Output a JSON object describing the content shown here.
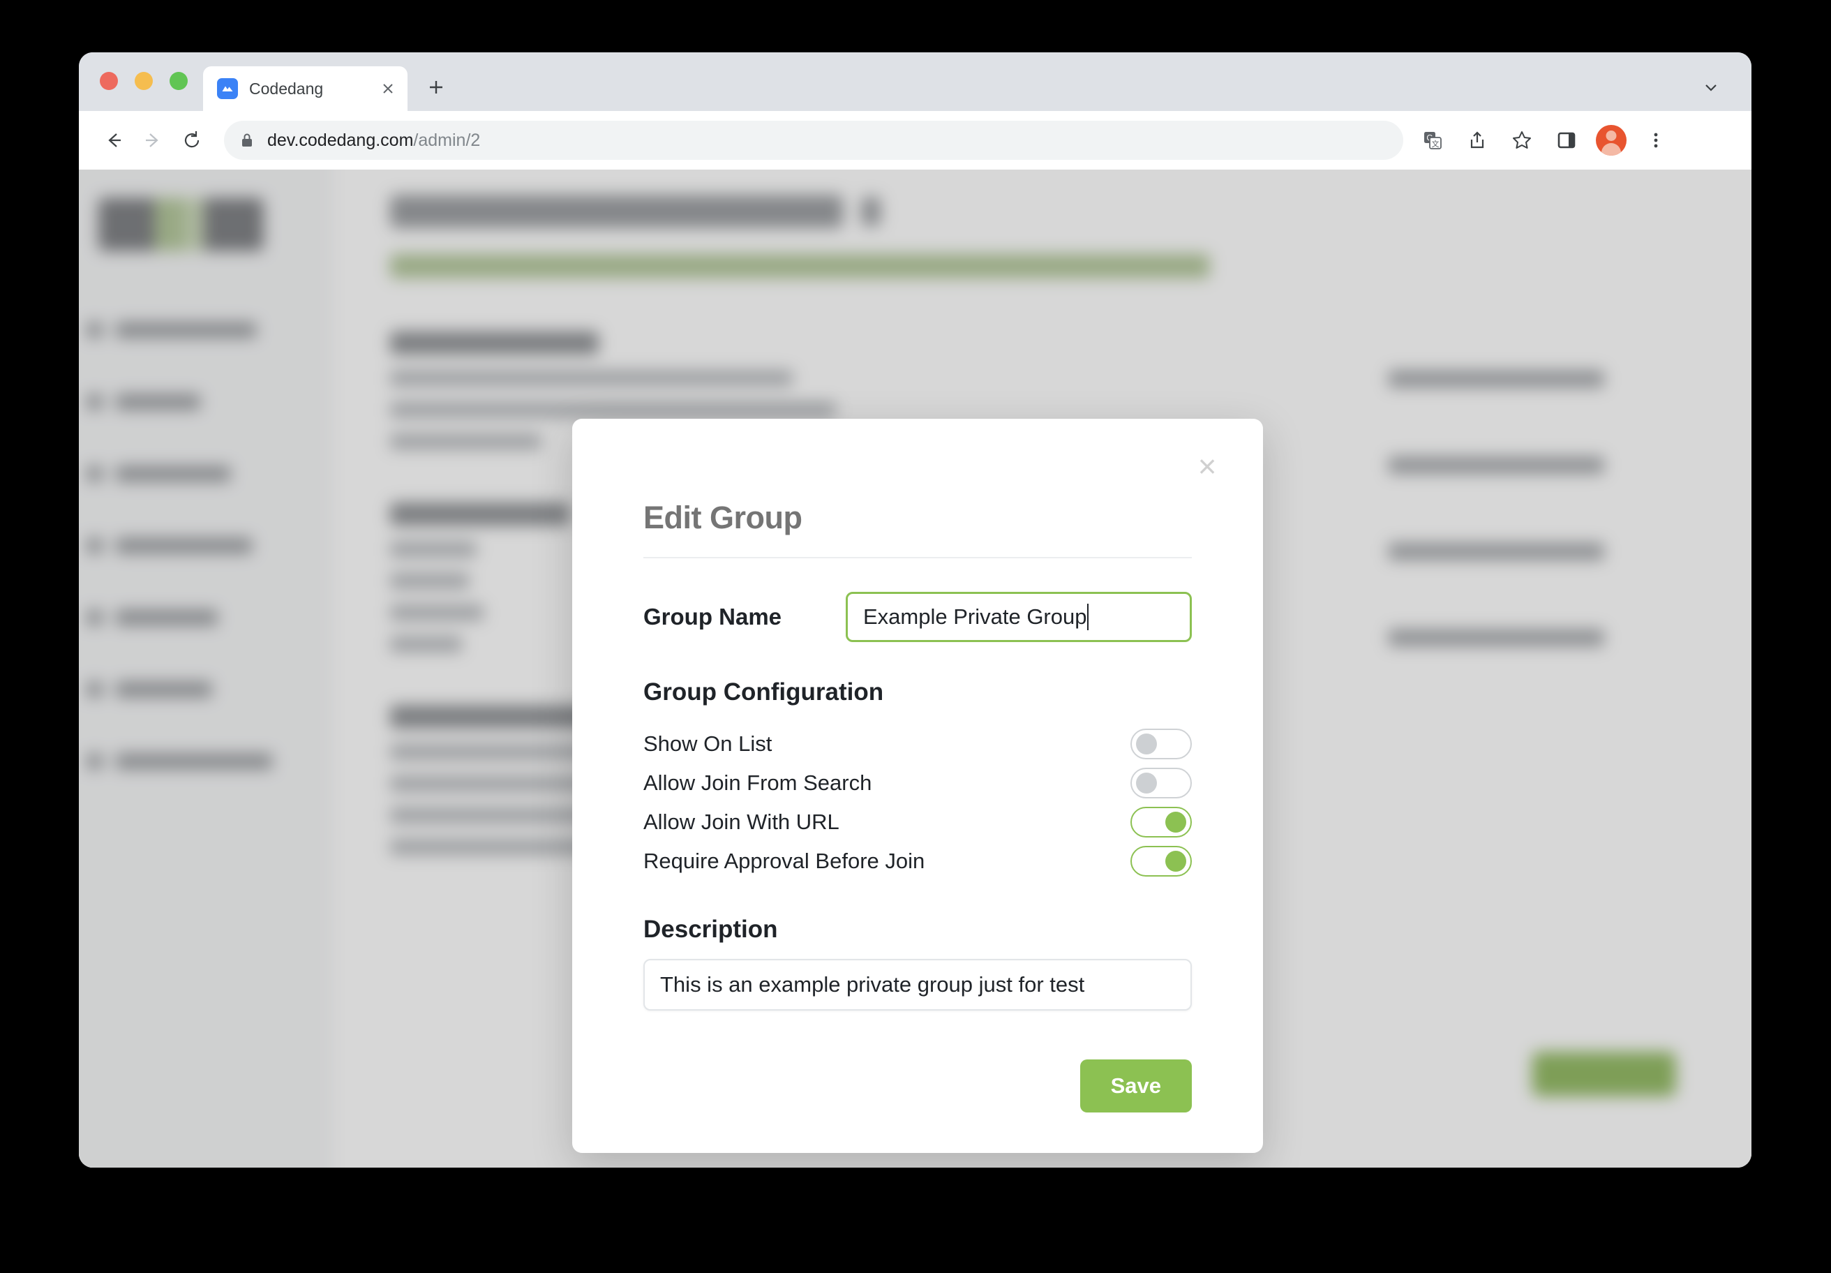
{
  "browser": {
    "tab": {
      "title": "Codedang",
      "favicon_icon": "codedang-logo-icon",
      "close_icon": "close-icon"
    },
    "new_tab_icon": "plus-icon",
    "tab_list_chevron_icon": "chevron-down-icon",
    "nav": {
      "back_icon": "arrow-left-icon",
      "forward_icon": "arrow-right-icon",
      "reload_icon": "reload-icon"
    },
    "omnibox": {
      "lock_icon": "lock-icon",
      "url_domain": "dev.codedang.com",
      "url_path": "/admin/2"
    },
    "toolbar_icons": [
      "translate-icon",
      "share-icon",
      "bookmark-star-icon",
      "side-panel-icon",
      "profile-avatar",
      "more-menu-icon"
    ]
  },
  "modal": {
    "title": "Edit Group",
    "close_icon": "close-icon",
    "group_name": {
      "label": "Group Name",
      "value": "Example Private Group",
      "focused": true
    },
    "configuration": {
      "title": "Group Configuration",
      "toggles": [
        {
          "label": "Show On List",
          "on": false
        },
        {
          "label": "Allow Join From Search",
          "on": false
        },
        {
          "label": "Allow Join With URL",
          "on": true
        },
        {
          "label": "Require Approval Before Join",
          "on": true
        }
      ]
    },
    "description": {
      "title": "Description",
      "value": "This is an example private group just for test"
    },
    "save_label": "Save"
  },
  "colors": {
    "accent_green": "#8cc152",
    "save_button": "#8cc152",
    "toggle_off": "#cdd0d3",
    "tab_favicon": "#3b82f6",
    "avatar": "#e8542f"
  }
}
